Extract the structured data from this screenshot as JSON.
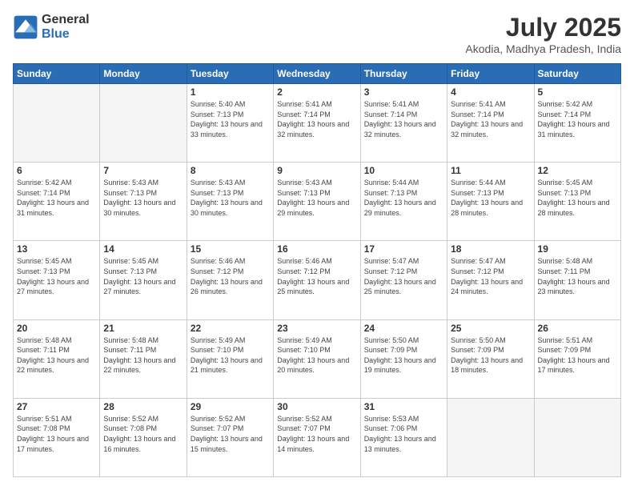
{
  "logo": {
    "general": "General",
    "blue": "Blue"
  },
  "title": "July 2025",
  "subtitle": "Akodia, Madhya Pradesh, India",
  "days_of_week": [
    "Sunday",
    "Monday",
    "Tuesday",
    "Wednesday",
    "Thursday",
    "Friday",
    "Saturday"
  ],
  "weeks": [
    [
      {
        "day": "",
        "info": ""
      },
      {
        "day": "",
        "info": ""
      },
      {
        "day": "1",
        "info": "Sunrise: 5:40 AM\nSunset: 7:13 PM\nDaylight: 13 hours and 33 minutes."
      },
      {
        "day": "2",
        "info": "Sunrise: 5:41 AM\nSunset: 7:14 PM\nDaylight: 13 hours and 32 minutes."
      },
      {
        "day": "3",
        "info": "Sunrise: 5:41 AM\nSunset: 7:14 PM\nDaylight: 13 hours and 32 minutes."
      },
      {
        "day": "4",
        "info": "Sunrise: 5:41 AM\nSunset: 7:14 PM\nDaylight: 13 hours and 32 minutes."
      },
      {
        "day": "5",
        "info": "Sunrise: 5:42 AM\nSunset: 7:14 PM\nDaylight: 13 hours and 31 minutes."
      }
    ],
    [
      {
        "day": "6",
        "info": "Sunrise: 5:42 AM\nSunset: 7:14 PM\nDaylight: 13 hours and 31 minutes."
      },
      {
        "day": "7",
        "info": "Sunrise: 5:43 AM\nSunset: 7:13 PM\nDaylight: 13 hours and 30 minutes."
      },
      {
        "day": "8",
        "info": "Sunrise: 5:43 AM\nSunset: 7:13 PM\nDaylight: 13 hours and 30 minutes."
      },
      {
        "day": "9",
        "info": "Sunrise: 5:43 AM\nSunset: 7:13 PM\nDaylight: 13 hours and 29 minutes."
      },
      {
        "day": "10",
        "info": "Sunrise: 5:44 AM\nSunset: 7:13 PM\nDaylight: 13 hours and 29 minutes."
      },
      {
        "day": "11",
        "info": "Sunrise: 5:44 AM\nSunset: 7:13 PM\nDaylight: 13 hours and 28 minutes."
      },
      {
        "day": "12",
        "info": "Sunrise: 5:45 AM\nSunset: 7:13 PM\nDaylight: 13 hours and 28 minutes."
      }
    ],
    [
      {
        "day": "13",
        "info": "Sunrise: 5:45 AM\nSunset: 7:13 PM\nDaylight: 13 hours and 27 minutes."
      },
      {
        "day": "14",
        "info": "Sunrise: 5:45 AM\nSunset: 7:13 PM\nDaylight: 13 hours and 27 minutes."
      },
      {
        "day": "15",
        "info": "Sunrise: 5:46 AM\nSunset: 7:12 PM\nDaylight: 13 hours and 26 minutes."
      },
      {
        "day": "16",
        "info": "Sunrise: 5:46 AM\nSunset: 7:12 PM\nDaylight: 13 hours and 25 minutes."
      },
      {
        "day": "17",
        "info": "Sunrise: 5:47 AM\nSunset: 7:12 PM\nDaylight: 13 hours and 25 minutes."
      },
      {
        "day": "18",
        "info": "Sunrise: 5:47 AM\nSunset: 7:12 PM\nDaylight: 13 hours and 24 minutes."
      },
      {
        "day": "19",
        "info": "Sunrise: 5:48 AM\nSunset: 7:11 PM\nDaylight: 13 hours and 23 minutes."
      }
    ],
    [
      {
        "day": "20",
        "info": "Sunrise: 5:48 AM\nSunset: 7:11 PM\nDaylight: 13 hours and 22 minutes."
      },
      {
        "day": "21",
        "info": "Sunrise: 5:48 AM\nSunset: 7:11 PM\nDaylight: 13 hours and 22 minutes."
      },
      {
        "day": "22",
        "info": "Sunrise: 5:49 AM\nSunset: 7:10 PM\nDaylight: 13 hours and 21 minutes."
      },
      {
        "day": "23",
        "info": "Sunrise: 5:49 AM\nSunset: 7:10 PM\nDaylight: 13 hours and 20 minutes."
      },
      {
        "day": "24",
        "info": "Sunrise: 5:50 AM\nSunset: 7:09 PM\nDaylight: 13 hours and 19 minutes."
      },
      {
        "day": "25",
        "info": "Sunrise: 5:50 AM\nSunset: 7:09 PM\nDaylight: 13 hours and 18 minutes."
      },
      {
        "day": "26",
        "info": "Sunrise: 5:51 AM\nSunset: 7:09 PM\nDaylight: 13 hours and 17 minutes."
      }
    ],
    [
      {
        "day": "27",
        "info": "Sunrise: 5:51 AM\nSunset: 7:08 PM\nDaylight: 13 hours and 17 minutes."
      },
      {
        "day": "28",
        "info": "Sunrise: 5:52 AM\nSunset: 7:08 PM\nDaylight: 13 hours and 16 minutes."
      },
      {
        "day": "29",
        "info": "Sunrise: 5:52 AM\nSunset: 7:07 PM\nDaylight: 13 hours and 15 minutes."
      },
      {
        "day": "30",
        "info": "Sunrise: 5:52 AM\nSunset: 7:07 PM\nDaylight: 13 hours and 14 minutes."
      },
      {
        "day": "31",
        "info": "Sunrise: 5:53 AM\nSunset: 7:06 PM\nDaylight: 13 hours and 13 minutes."
      },
      {
        "day": "",
        "info": ""
      },
      {
        "day": "",
        "info": ""
      }
    ]
  ]
}
